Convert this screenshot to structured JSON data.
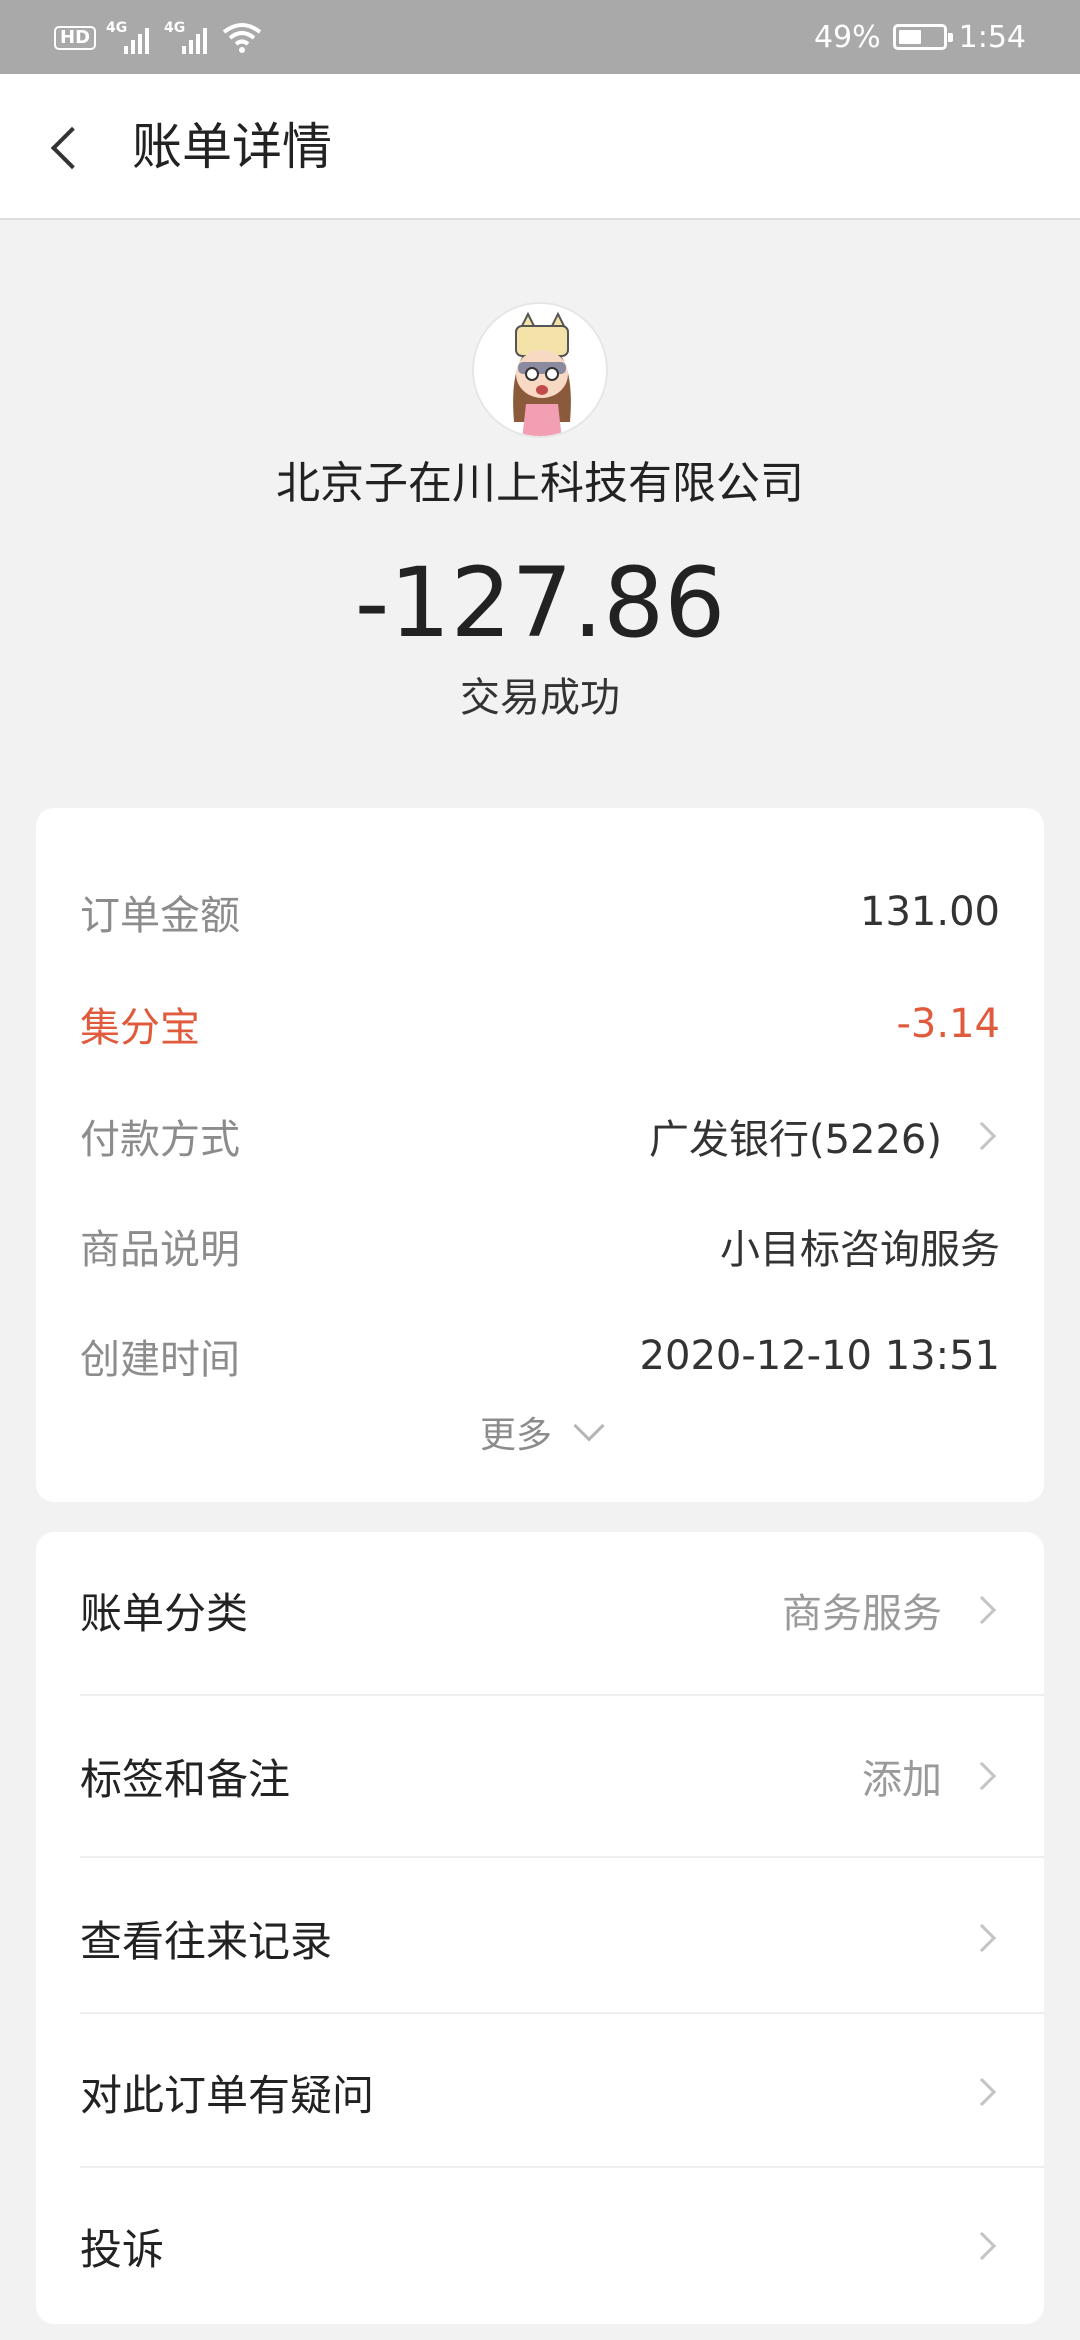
{
  "status_bar": {
    "hd": "HD",
    "sim1": "4G",
    "sim2": "4G",
    "battery_text": "49%",
    "battery_level": 0.49,
    "time": "1:54"
  },
  "header": {
    "title": "账单详情"
  },
  "summary": {
    "merchant": "北京子在川上科技有限公司",
    "amount": "-127.86",
    "status": "交易成功"
  },
  "details": {
    "order_amount": {
      "label": "订单金额",
      "value": "131.00"
    },
    "jifenbao": {
      "label": "集分宝",
      "value": "-3.14"
    },
    "payment": {
      "label": "付款方式",
      "value": "广发银行(5226)"
    },
    "product": {
      "label": "商品说明",
      "value": "小目标咨询服务"
    },
    "created": {
      "label": "创建时间",
      "value": "2020-12-10 13:51"
    },
    "more": "更多"
  },
  "actions": {
    "category": {
      "label": "账单分类",
      "value": "商务服务"
    },
    "tags": {
      "label": "标签和备注",
      "value": "添加"
    },
    "history": {
      "label": "查看往来记录"
    },
    "question": {
      "label": "对此订单有疑问"
    },
    "complain": {
      "label": "投诉"
    }
  },
  "colors": {
    "status_bar": "#a9a9a9",
    "page_bg": "#f2f2f2",
    "accent_red": "#e05a3c"
  }
}
